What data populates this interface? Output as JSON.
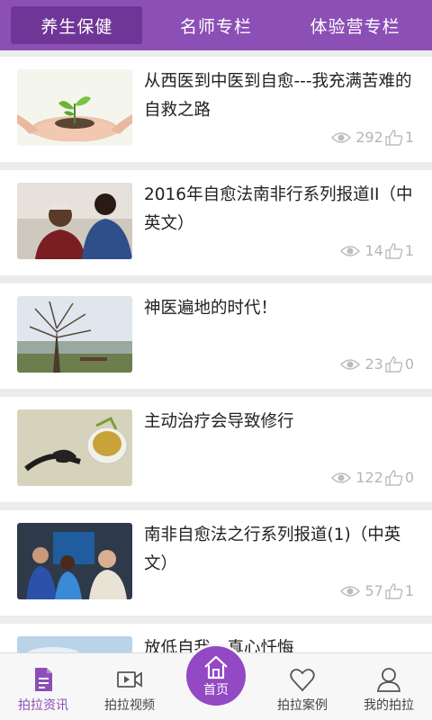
{
  "tabs": [
    {
      "label": "养生保健",
      "active": true
    },
    {
      "label": "名师专栏",
      "active": false
    },
    {
      "label": "体验营专栏",
      "active": false
    }
  ],
  "articles": [
    {
      "title": "从西医到中医到自愈---我充满苦难的自救之路",
      "views": "292",
      "likes": "1",
      "thumb": "sprout-in-hands-image"
    },
    {
      "title": "2016年自愈法南非行系列报道II（中英文）",
      "views": "14",
      "likes": "1",
      "thumb": "people-portrait-image"
    },
    {
      "title": "神医遍地的时代！",
      "views": "23",
      "likes": "0",
      "thumb": "park-tree-image"
    },
    {
      "title": "主动治疗会导致修行",
      "views": "122",
      "likes": "0",
      "thumb": "tea-pour-image"
    },
    {
      "title": "南非自愈法之行系列报道(1)（中英文）",
      "views": "57",
      "likes": "1",
      "thumb": "studio-group-image"
    },
    {
      "title": "放低自我，真心忏悔",
      "views": "",
      "likes": "",
      "thumb": "sky-image"
    }
  ],
  "nav": {
    "items": [
      {
        "label": "拍拉资讯",
        "icon": "document-icon",
        "active": true
      },
      {
        "label": "拍拉视频",
        "icon": "video-icon",
        "active": false
      },
      {
        "label": "首页",
        "icon": "home-icon",
        "active": false
      },
      {
        "label": "拍拉案例",
        "icon": "heart-icon",
        "active": false
      },
      {
        "label": "我的拍拉",
        "icon": "user-icon",
        "active": false
      }
    ]
  },
  "colors": {
    "brand": "#8c4fb6",
    "brand_dark": "#6f3597",
    "stat_gray": "#b5b5b5"
  }
}
